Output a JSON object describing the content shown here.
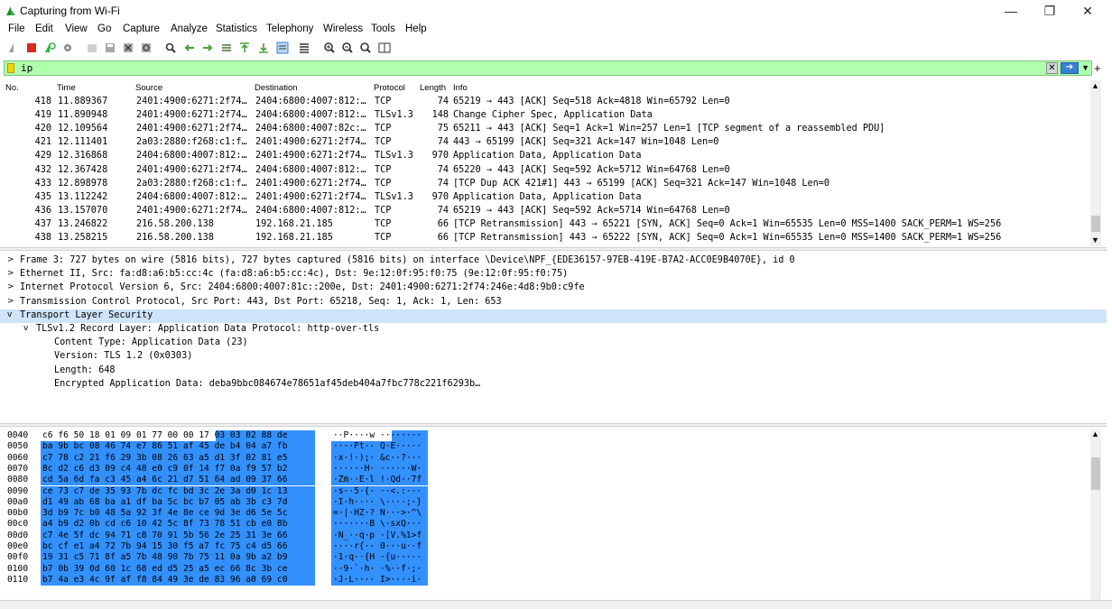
{
  "window": {
    "title": "Capturing from Wi-Fi",
    "controls": [
      "—",
      "❐",
      "✕"
    ]
  },
  "menu": [
    "File",
    "Edit",
    "View",
    "Go",
    "Capture",
    "Analyze",
    "Statistics",
    "Telephony",
    "Wireless",
    "Tools",
    "Help"
  ],
  "toolbar_icons": [
    "shark-fin-start-icon",
    "stop-capture-icon",
    "restart-capture-icon",
    "capture-options-icon",
    "open-file-icon",
    "save-file-icon",
    "close-file-icon",
    "reload-icon",
    "find-packet-icon",
    "go-back-icon",
    "go-forward-icon",
    "go-to-packet-icon",
    "go-first-icon",
    "go-last-icon",
    "autoscroll-icon",
    "colorize-icon",
    "zoom-in-icon",
    "zoom-out-icon",
    "zoom-normal-icon",
    "resize-columns-icon"
  ],
  "filter": {
    "value": "ip",
    "accent": "#afffaf"
  },
  "packet_list": {
    "columns": [
      "No.",
      "Time",
      "Source",
      "Destination",
      "Protocol",
      "Length",
      "Info"
    ],
    "rows": [
      [
        "418",
        "11.889367",
        "2401:4900:6271:2f74…",
        "2404:6800:4007:812:…",
        "TCP",
        "74",
        "65219 → 443 [ACK] Seq=518 Ack=4818 Win=65792 Len=0"
      ],
      [
        "419",
        "11.890948",
        "2401:4900:6271:2f74…",
        "2404:6800:4007:812:…",
        "TLSv1.3",
        "148",
        "Change Cipher Spec, Application Data"
      ],
      [
        "420",
        "12.109564",
        "2401:4900:6271:2f74…",
        "2404:6800:4007:82c:…",
        "TCP",
        "75",
        "65211 → 443 [ACK] Seq=1 Ack=1 Win=257 Len=1 [TCP segment of a reassembled PDU]"
      ],
      [
        "421",
        "12.111401",
        "2a03:2880:f268:c1:f…",
        "2401:4900:6271:2f74…",
        "TCP",
        "74",
        "443 → 65199 [ACK] Seq=321 Ack=147 Win=1048 Len=0"
      ],
      [
        "429",
        "12.316868",
        "2404:6800:4007:812:…",
        "2401:4900:6271:2f74…",
        "TLSv1.3",
        "970",
        "Application Data, Application Data"
      ],
      [
        "432",
        "12.367428",
        "2401:4900:6271:2f74…",
        "2404:6800:4007:812:…",
        "TCP",
        "74",
        "65220 → 443 [ACK] Seq=592 Ack=5712 Win=64768 Len=0"
      ],
      [
        "433",
        "12.898978",
        "2a03:2880:f268:c1:f…",
        "2401:4900:6271:2f74…",
        "TCP",
        "74",
        "[TCP Dup ACK 421#1] 443 → 65199 [ACK] Seq=321 Ack=147 Win=1048 Len=0"
      ],
      [
        "435",
        "13.112242",
        "2404:6800:4007:812:…",
        "2401:4900:6271:2f74…",
        "TLSv1.3",
        "970",
        "Application Data, Application Data"
      ],
      [
        "436",
        "13.157070",
        "2401:4900:6271:2f74…",
        "2404:6800:4007:812:…",
        "TCP",
        "74",
        "65219 → 443 [ACK] Seq=592 Ack=5714 Win=64768 Len=0"
      ],
      [
        "437",
        "13.246822",
        "216.58.200.138",
        "192.168.21.185",
        "TCP",
        "66",
        "[TCP Retransmission] 443 → 65221 [SYN, ACK] Seq=0 Ack=1 Win=65535 Len=0 MSS=1400 SACK_PERM=1 WS=256"
      ],
      [
        "438",
        "13.258215",
        "216.58.200.138",
        "192.168.21.185",
        "TCP",
        "66",
        "[TCP Retransmission] 443 → 65222 [SYN, ACK] Seq=0 Ack=1 Win=65535 Len=0 MSS=1400 SACK_PERM=1 WS=256"
      ]
    ]
  },
  "details": [
    {
      "indent": 0,
      "toggle": ">",
      "text": "Frame 3: 727 bytes on wire (5816 bits), 727 bytes captured (5816 bits) on interface \\Device\\NPF_{EDE36157-97EB-419E-B7A2-ACC0E9B4070E}, id 0",
      "selected": false
    },
    {
      "indent": 0,
      "toggle": ">",
      "text": "Ethernet II, Src: fa:d8:a6:b5:cc:4c (fa:d8:a6:b5:cc:4c), Dst: 9e:12:0f:95:f0:75 (9e:12:0f:95:f0:75)",
      "selected": false
    },
    {
      "indent": 0,
      "toggle": ">",
      "text": "Internet Protocol Version 6, Src: 2404:6800:4007:81c::200e, Dst: 2401:4900:6271:2f74:246e:4d8:9b0:c9fe",
      "selected": false
    },
    {
      "indent": 0,
      "toggle": ">",
      "text": "Transmission Control Protocol, Src Port: 443, Dst Port: 65218, Seq: 1, Ack: 1, Len: 653",
      "selected": false
    },
    {
      "indent": 0,
      "toggle": "v",
      "text": "Transport Layer Security",
      "selected": true
    },
    {
      "indent": 1,
      "toggle": "v",
      "text": "TLSv1.2 Record Layer: Application Data Protocol: http-over-tls",
      "selected": false
    },
    {
      "indent": 2,
      "toggle": "",
      "text": "Content Type: Application Data (23)",
      "selected": false
    },
    {
      "indent": 2,
      "toggle": "",
      "text": "Version: TLS 1.2 (0x0303)",
      "selected": false
    },
    {
      "indent": 2,
      "toggle": "",
      "text": "Length: 648",
      "selected": false
    },
    {
      "indent": 2,
      "toggle": "",
      "text": "Encrypted Application Data: deba9bbc084674e78651af45deb404a7fbc778c221f6293b…",
      "selected": false
    }
  ],
  "bytes": [
    {
      "off": "0040",
      "hex": "c6 f6 50 18 01 09 01 77  00 00 17 03 03 02 88 de",
      "ascii": "··P····w ········"
    },
    {
      "off": "0050",
      "hex": "ba 9b bc 08 46 74 e7 86  51 af 45 de b4 04 a7 fb",
      "ascii": "····Ft·· Q·E·····"
    },
    {
      "off": "0060",
      "hex": "c7 78 c2 21 f6 29 3b 08  26 63 a5 d1 3f 02 81 e5",
      "ascii": "·x·!·);· &c··?···"
    },
    {
      "off": "0070",
      "hex": "8c d2 c6 d3 09 c4 48 e0  c9 0f 14 f7 0a f9 57 b2",
      "ascii": "······H· ······W·"
    },
    {
      "off": "0080",
      "hex": "cd 5a 6d fa c3 45 a4 6c  21 d7 51 64 ad 09 37 66",
      "ascii": "·Zm··E·l !·Qd··7f"
    },
    {
      "off": "0090",
      "hex": "ce 73 c7 de 35 93 7b dc  fc bd 3c 2e 3a d0 1c 13",
      "ascii": "·s··5·{· ··<.:···"
    },
    {
      "off": "00a0",
      "hex": "d1 49 ab 68 ba a1 df ba  5c bc b7 05 ab 3b c3 7d",
      "ascii": "·I·h···· \\····;·}"
    },
    {
      "off": "00b0",
      "hex": "3d b9 7c b0 48 5a 92 3f  4e 8e ce 9d 3e d6 5e 5c",
      "ascii": "=·|·HZ·? N···>·^\\"
    },
    {
      "off": "00c0",
      "hex": "a4 b9 d2 0b cd c6 10 42  5c 8f 73 78 51 cb e0 8b",
      "ascii": "·······B \\·sxQ···"
    },
    {
      "off": "00d0",
      "hex": "c7 4e 5f dc 94 71 c8 70  91 5b 56 2e 25 31 3e 66",
      "ascii": "·N_··q·p ·[V.%1>f"
    },
    {
      "off": "00e0",
      "hex": "bc cf e1 a4 72 7b 94 15  30 f5 a7 fc 75 c4 d5 66",
      "ascii": "····r{·· 0···u··f"
    },
    {
      "off": "00f0",
      "hex": "19 31 c5 71 8f a5 7b 48  90 7b 75 11 0a 9b a2 b9",
      "ascii": "·1·q··{H ·{u·····"
    },
    {
      "off": "0100",
      "hex": "b7 0b 39 0d 60 1c 68 ed  d5 25 a5 ec 66 8c 3b ce",
      "ascii": "··9·`·h· ·%··f·;·"
    },
    {
      "off": "0110",
      "hex": "b7 4a e3 4c 9f af f8 84  49 3e de 83 96 a0 69 c0",
      "ascii": "·J·L···· I>····i·"
    }
  ]
}
